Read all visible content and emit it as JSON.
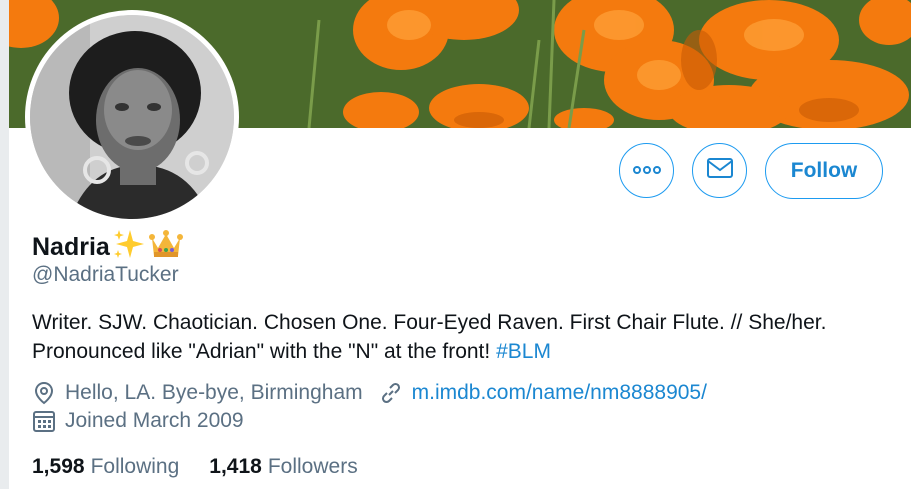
{
  "profile": {
    "display_name": "Nadria",
    "name_emojis": [
      "sparkles-emoji",
      "crown-emoji"
    ],
    "handle": "@NadriaTucker",
    "bio_text": "Writer. SJW. Chaotician. Chosen One. Four-Eyed Raven. First Chair Flute. // She/her. Pronounced like \"Adrian\" with the \"N\" at the front!",
    "bio_hashtag": "#BLM",
    "location": "Hello, LA. Bye-bye, Birmingham",
    "website": "m.imdb.com/name/nm8888905/",
    "joined": "Joined March 2009"
  },
  "actions": {
    "more_icon": "more-icon",
    "message_icon": "mail-icon",
    "follow_label": "Follow"
  },
  "stats": {
    "following_count": "1,598",
    "following_label": "Following",
    "followers_count": "1,418",
    "followers_label": "Followers"
  },
  "colors": {
    "accent": "#1b87d1",
    "muted": "#5b7083",
    "banner_flower": "#f57a10"
  }
}
